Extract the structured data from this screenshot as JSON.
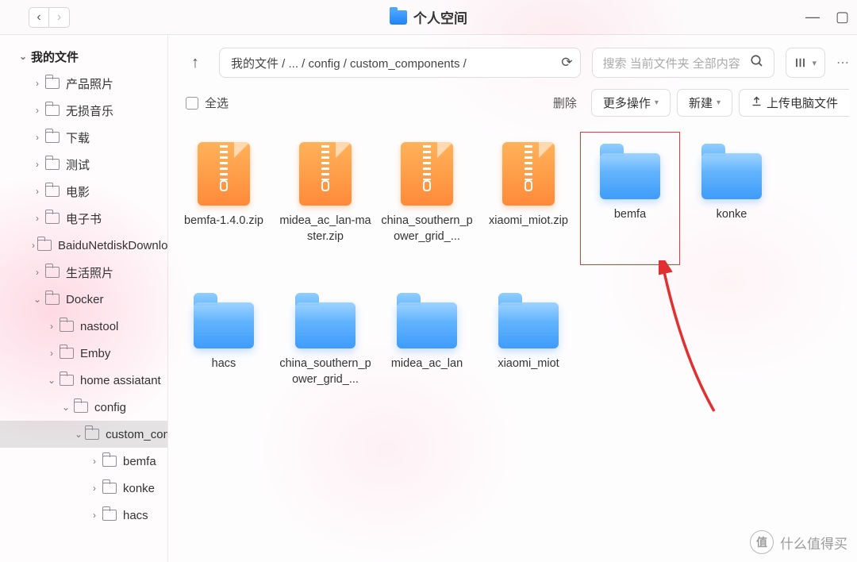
{
  "title": "个人空间",
  "winctl": {
    "min": "—",
    "max": "▢"
  },
  "sidebar": {
    "root": "我的文件",
    "items": [
      {
        "label": "产品照片",
        "indent": 2,
        "chev": "›"
      },
      {
        "label": "无损音乐",
        "indent": 2,
        "chev": "›"
      },
      {
        "label": "下载",
        "indent": 2,
        "chev": "›"
      },
      {
        "label": "测试",
        "indent": 2,
        "chev": "›"
      },
      {
        "label": "电影",
        "indent": 2,
        "chev": "›"
      },
      {
        "label": "电子书",
        "indent": 2,
        "chev": "›"
      },
      {
        "label": "BaiduNetdiskDownload",
        "indent": 2,
        "chev": "›"
      },
      {
        "label": "生活照片",
        "indent": 2,
        "chev": "›"
      },
      {
        "label": "Docker",
        "indent": 2,
        "chev": "⌄"
      },
      {
        "label": "nastool",
        "indent": 3,
        "chev": "›"
      },
      {
        "label": "Emby",
        "indent": 3,
        "chev": "›"
      },
      {
        "label": "home assiatant",
        "indent": 3,
        "chev": "⌄"
      },
      {
        "label": "config",
        "indent": 4,
        "chev": "⌄"
      },
      {
        "label": "custom_components",
        "indent": 5,
        "chev": "⌄",
        "sel": true
      },
      {
        "label": "bemfa",
        "indent": 6,
        "chev": "›"
      },
      {
        "label": "konke",
        "indent": 6,
        "chev": "›"
      },
      {
        "label": "hacs",
        "indent": 6,
        "chev": "›"
      }
    ]
  },
  "toolbar": {
    "breadcrumb": "我的文件 / ... / config / custom_components /",
    "search_placeholder": "搜索 当前文件夹 全部内容",
    "view_glyph": "||"
  },
  "actions": {
    "select_all": "全选",
    "delete": "删除",
    "more": "更多操作",
    "new": "新建",
    "upload": "上传电脑文件"
  },
  "files": [
    {
      "name": "bemfa-1.4.0.zip",
      "type": "zip"
    },
    {
      "name": "midea_ac_lan-master.zip",
      "type": "zip"
    },
    {
      "name": "china_southern_power_grid_...",
      "type": "zip"
    },
    {
      "name": "xiaomi_miot.zip",
      "type": "zip"
    },
    {
      "name": "bemfa",
      "type": "folder",
      "highlight": true
    },
    {
      "name": "konke",
      "type": "folder"
    },
    {
      "name": "hacs",
      "type": "folder"
    },
    {
      "name": "china_southern_power_grid_...",
      "type": "folder"
    },
    {
      "name": "midea_ac_lan",
      "type": "folder"
    },
    {
      "name": "xiaomi_miot",
      "type": "folder"
    }
  ],
  "watermark": {
    "badge": "值",
    "text": "什么值得买"
  }
}
